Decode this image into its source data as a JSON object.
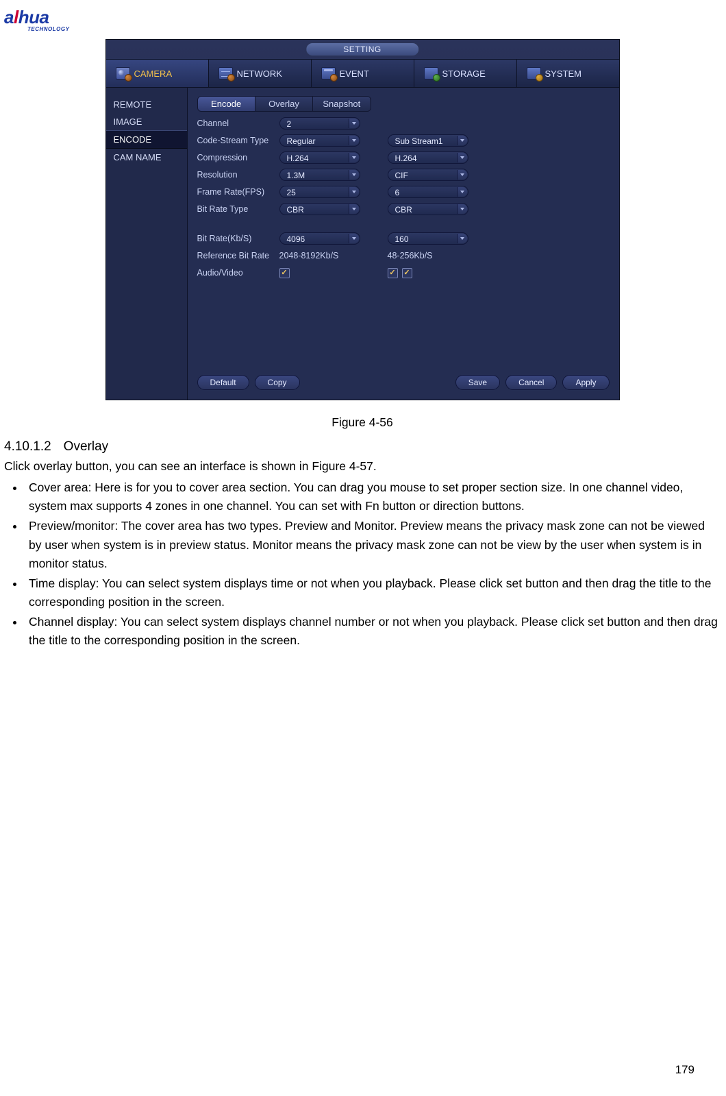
{
  "logo": {
    "text_a": "a",
    "text_l": "l",
    "text_hua": "hua",
    "sub": "TECHNOLOGY"
  },
  "panel": {
    "title": "SETTING",
    "main_tabs": [
      {
        "label": "CAMERA"
      },
      {
        "label": "NETWORK"
      },
      {
        "label": "EVENT"
      },
      {
        "label": "STORAGE"
      },
      {
        "label": "SYSTEM"
      }
    ],
    "sidebar": [
      {
        "label": "REMOTE"
      },
      {
        "label": "IMAGE"
      },
      {
        "label": "ENCODE"
      },
      {
        "label": "CAM NAME"
      }
    ],
    "sub_tabs": [
      {
        "label": "Encode"
      },
      {
        "label": "Overlay"
      },
      {
        "label": "Snapshot"
      }
    ],
    "rows": {
      "channel": {
        "label": "Channel",
        "a": "2"
      },
      "code_stream": {
        "label": "Code-Stream Type",
        "a": "Regular",
        "b": "Sub Stream1"
      },
      "compression": {
        "label": "Compression",
        "a": "H.264",
        "b": "H.264"
      },
      "resolution": {
        "label": "Resolution",
        "a": "1.3M",
        "b": "CIF"
      },
      "frame_rate": {
        "label": "Frame Rate(FPS)",
        "a": "25",
        "b": "6"
      },
      "bit_rate_type": {
        "label": "Bit Rate Type",
        "a": "CBR",
        "b": "CBR"
      },
      "bit_rate": {
        "label": "Bit Rate(Kb/S)",
        "a": "4096",
        "b": "160"
      },
      "ref_bit_rate": {
        "label": "Reference Bit Rate",
        "a": "2048-8192Kb/S",
        "b": "48-256Kb/S"
      },
      "audio_video": {
        "label": "Audio/Video"
      }
    },
    "buttons": {
      "default": "Default",
      "copy": "Copy",
      "save": "Save",
      "cancel": "Cancel",
      "apply": "Apply"
    }
  },
  "doc": {
    "figure_caption": "Figure 4-56",
    "section_num": "4.10.1.2",
    "section_title": "Overlay",
    "intro": "Click overlay button, you can see an interface is shown in Figure 4-57.",
    "bullets": [
      "Cover area: Here is for you to cover area section. You can drag you mouse to set proper section size. In one channel video, system max supports 4 zones in one channel. You can set with Fn button or direction buttons.",
      "Preview/monitor: The cover area has two types. Preview and Monitor. Preview means the privacy mask zone can not be viewed by user when system is in preview status. Monitor means the privacy mask zone can not be view by the user when system is in monitor status.",
      "Time display: You can select system displays time or not when you playback. Please click set button and then drag the title to the corresponding position in the screen.",
      "Channel display: You can select system displays channel number or not when you playback. Please click set button and then drag the title to the corresponding position in the screen."
    ],
    "page_num": "179"
  }
}
